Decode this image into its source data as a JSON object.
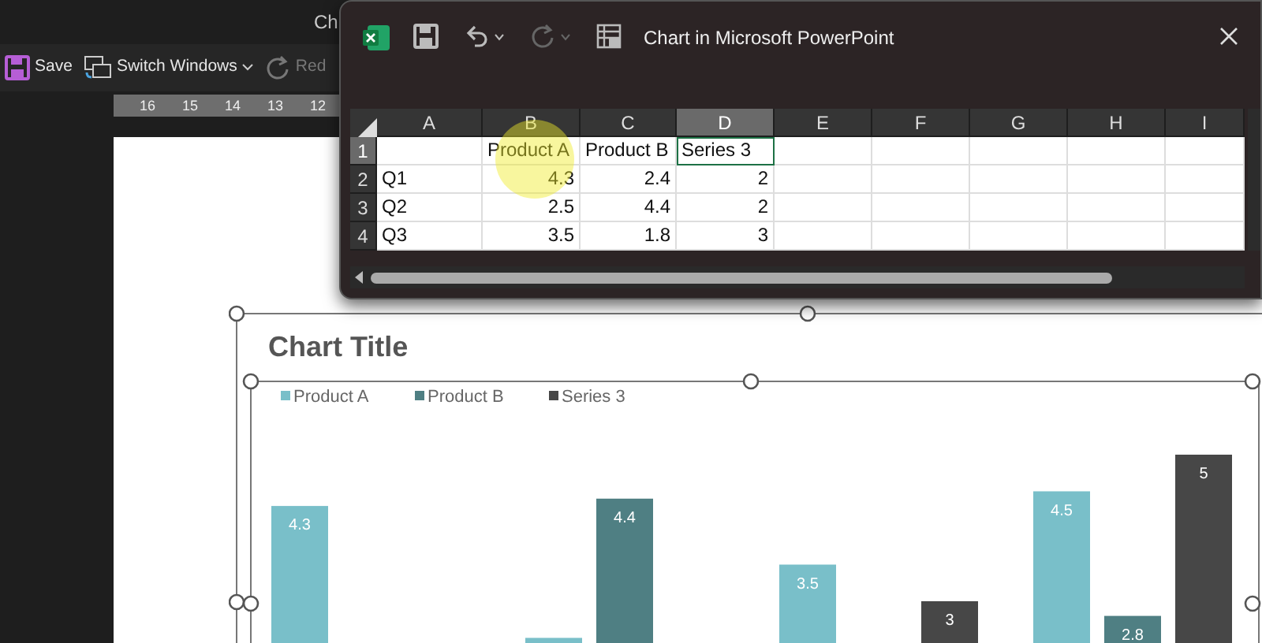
{
  "powerpoint": {
    "title": "Ch",
    "toolbar": [
      {
        "kind": "save",
        "label": "Save",
        "disabled": false
      },
      {
        "kind": "switch",
        "label": "Switch Windows",
        "disabled": false
      },
      {
        "kind": "redo",
        "label": "Red",
        "disabled": true
      }
    ],
    "ruler": [
      "16",
      "15",
      "14",
      "13",
      "12"
    ]
  },
  "excel_window": {
    "title": "Chart in Microsoft PowerPoint",
    "quick_access": [
      {
        "kind": "save",
        "disabled": false
      },
      {
        "kind": "undo",
        "disabled": false
      },
      {
        "kind": "redo",
        "disabled": true
      },
      {
        "kind": "table",
        "disabled": false
      }
    ],
    "columns": [
      {
        "label": "A",
        "selected": false
      },
      {
        "label": "B",
        "selected": false
      },
      {
        "label": "C",
        "selected": false
      },
      {
        "label": "D",
        "selected": true
      },
      {
        "label": "E",
        "selected": false
      },
      {
        "label": "F",
        "selected": false
      },
      {
        "label": "G",
        "selected": false
      },
      {
        "label": "H",
        "selected": false
      },
      {
        "label": "I",
        "selected": false
      }
    ],
    "rows": [
      {
        "number": "1",
        "selected": true,
        "cells": [
          null,
          "Product A",
          "Product B",
          "Series 3"
        ]
      },
      {
        "number": "2",
        "selected": false,
        "cells": [
          "Q1",
          "4.3",
          "2.4",
          "2"
        ]
      },
      {
        "number": "3",
        "selected": false,
        "cells": [
          "Q2",
          "2.5",
          "4.4",
          "2"
        ]
      },
      {
        "number": "4",
        "selected": false,
        "cells": [
          "Q3",
          "3.5",
          "1.8",
          "3"
        ]
      }
    ]
  },
  "slide": {
    "chart": {
      "title": "Chart Title",
      "legend": [
        {
          "name": "Product A",
          "color": "#79bfc9"
        },
        {
          "name": "Product B",
          "color": "#4f7f83"
        },
        {
          "name": "Series 3",
          "color": "#474747"
        }
      ],
      "data_labels": [
        {
          "text": "4.3"
        },
        {
          "text": "4.4"
        },
        {
          "text": "3.5"
        },
        {
          "text": "3"
        },
        {
          "text": "4.5"
        },
        {
          "text": "2.8"
        },
        {
          "text": "5"
        }
      ]
    }
  }
}
